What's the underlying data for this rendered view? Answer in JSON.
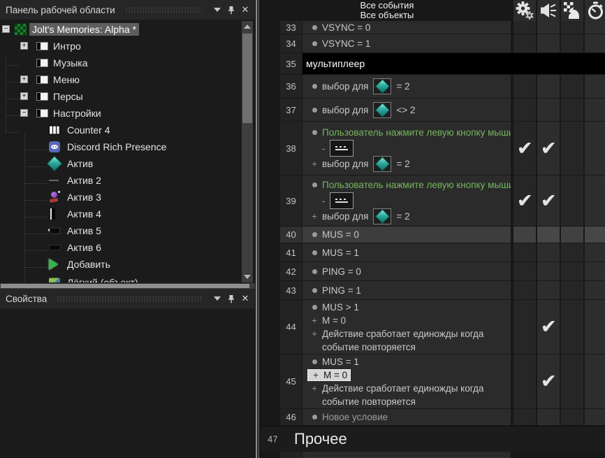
{
  "symbols": {
    "plus": "+",
    "check": "✔",
    "close": "✕"
  },
  "colors": {
    "condition_green": "#76b75c",
    "diamond_teal": "#2ea99c",
    "selection_gray": "#5e5e5e",
    "comment_row_bg": "#000000"
  },
  "workspace": {
    "title": "Панель рабочей области",
    "tree": {
      "root": {
        "label": "Jolt's Memories: Alpha *",
        "expand": "−",
        "icon": "game-thumbnail-icon"
      },
      "frames": [
        {
          "label": "Интро",
          "expand": "+",
          "icon": "frame-icon"
        },
        {
          "label": "Музыка",
          "expand": "",
          "icon": "frame-icon"
        },
        {
          "label": "Меню",
          "expand": "+",
          "icon": "frame-icon"
        },
        {
          "label": "Персы",
          "expand": "+",
          "icon": "frame-icon"
        },
        {
          "label": "Настройки",
          "expand": "−",
          "icon": "frame-icon"
        }
      ],
      "objects": [
        {
          "label": "Counter 4",
          "icon": "counter-icon"
        },
        {
          "label": "Discord Rich Presence",
          "icon": "discord-icon"
        },
        {
          "label": "Актив",
          "icon": "teal-diamond-icon"
        },
        {
          "label": "Актив 2",
          "icon": "thin-line-icon"
        },
        {
          "label": "Актив 3",
          "icon": "character-sprite-icon"
        },
        {
          "label": "Актив 4",
          "icon": "black-bar-icon"
        },
        {
          "label": "Актив 5",
          "icon": "black-rect-icon"
        },
        {
          "label": "Актив 6",
          "icon": "black-rect-icon"
        },
        {
          "label": "Добавить",
          "icon": "green-play-icon"
        },
        {
          "label": "Лёгкий (объект)",
          "icon": "image-icon"
        }
      ]
    }
  },
  "properties": {
    "title": "Свойства"
  },
  "events": {
    "header": {
      "line1": "Все события",
      "line2": "Все объекты",
      "column_icons": [
        "special-conditions-gears-icon",
        "sound-speaker-icon",
        "storyboard-controls-icon",
        "timer-stopwatch-icon"
      ]
    },
    "rows": {
      "r33": {
        "num": "33",
        "text": "VSYNC = 0"
      },
      "r34": {
        "num": "34",
        "text": "VSYNC = 1"
      },
      "r35": {
        "num": "35",
        "comment": "мультиплеер"
      },
      "r36": {
        "num": "36",
        "pre": "выбор для",
        "op": "= 2"
      },
      "r37": {
        "num": "37",
        "pre": "выбор для",
        "op": "<> 2"
      },
      "r38": {
        "num": "38",
        "cond1": "Пользователь нажмите левую кнопку мыши",
        "dash": "-",
        "pre": "выбор для",
        "op": "= 2"
      },
      "r39": {
        "num": "39",
        "cond1": "Пользователь нажмите левую кнопку мыши",
        "dash": "-",
        "pre": "выбор для",
        "op": "= 2"
      },
      "r40": {
        "num": "40",
        "text": "MUS = 0"
      },
      "r41": {
        "num": "41",
        "text": "MUS = 1"
      },
      "r42": {
        "num": "42",
        "text": "PING = 0"
      },
      "r43": {
        "num": "43",
        "text": "PING = 1"
      },
      "r44": {
        "num": "44",
        "cond1": "MUS > 1",
        "cond2": "M = 0",
        "cond3a": "Действие сработает единожды когда",
        "cond3b": "событие повторяется"
      },
      "r45": {
        "num": "45",
        "cond1": "MUS = 1",
        "cond2": "M = 0",
        "cond3a": "Действие сработает единожды когда",
        "cond3b": "событие повторяется"
      },
      "r46": {
        "num": "46",
        "text": "Новое условие"
      },
      "r47": {
        "num": "47",
        "group": "Прочее"
      }
    }
  }
}
